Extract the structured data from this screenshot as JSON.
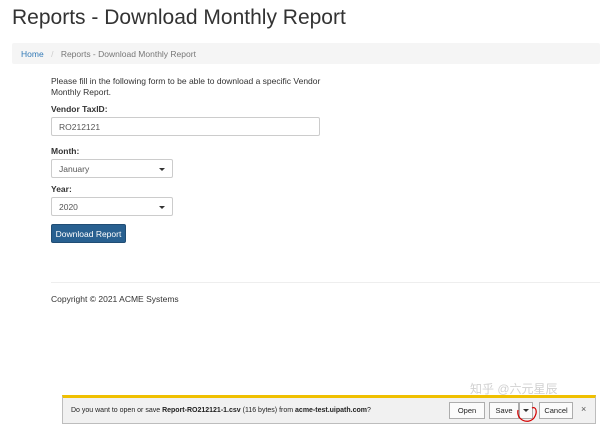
{
  "page": {
    "title": "Reports - Download Monthly Report"
  },
  "breadcrumb": {
    "home": "Home",
    "separator": "/",
    "current": "Reports - Download Monthly Report"
  },
  "form": {
    "intro": "Please fill in the following form to be able to download a specific Vendor Monthly Report.",
    "vendor_label": "Vendor TaxID:",
    "vendor_value": "RO212121",
    "month_label": "Month:",
    "month_value": "January",
    "year_label": "Year:",
    "year_value": "2020",
    "download_button": "Download Report"
  },
  "footer": {
    "copyright": "Copyright © 2021 ACME Systems"
  },
  "download_bar": {
    "prefix": "Do you want to open or save",
    "filename": "Report-RO212121-1.csv",
    "size": "(116 bytes) from",
    "host": "acme-test.uipath.com",
    "suffix": "?",
    "open_label": "Open",
    "save_label": "Save",
    "cancel_label": "Cancel",
    "close_glyph": "×",
    "accent_color": "#f0c000"
  },
  "watermark": "知乎 @六元星辰",
  "icons": {
    "select_caret": "caret-down-icon",
    "save_dropdown": "caret-down-icon",
    "close": "close-icon"
  }
}
